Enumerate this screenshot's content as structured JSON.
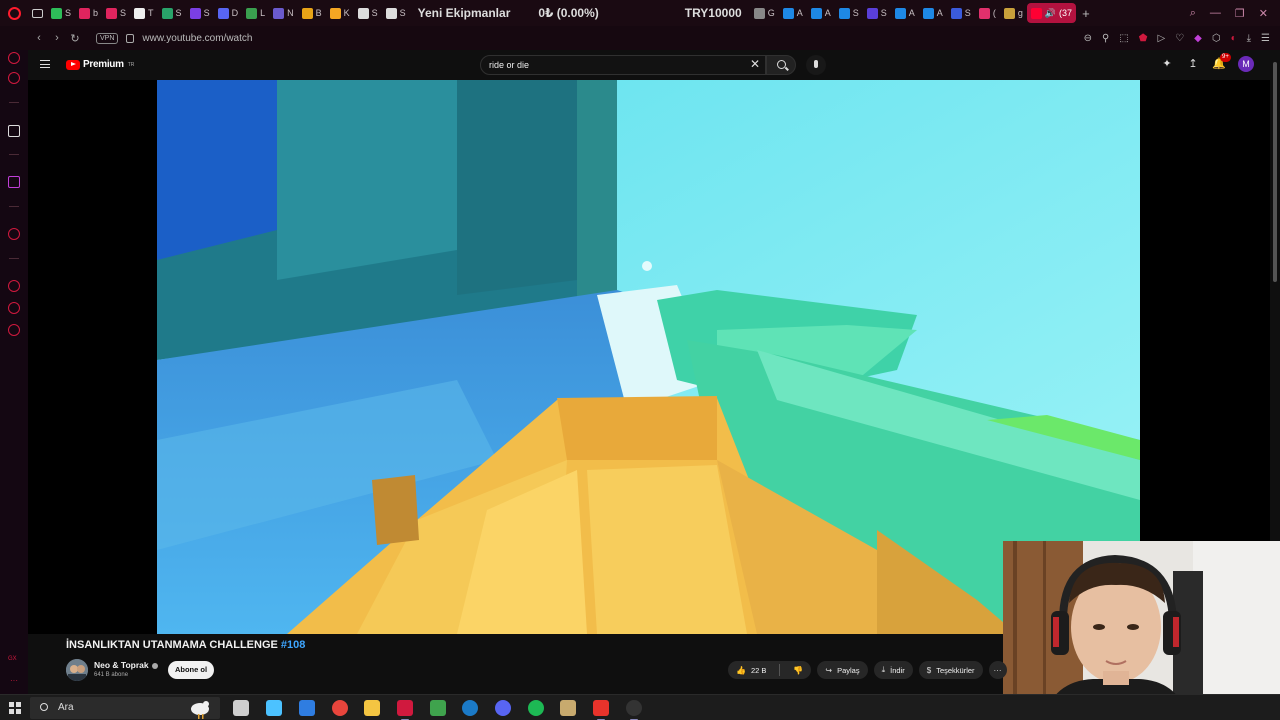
{
  "browser": {
    "tabs": [
      {
        "label": "S",
        "color": "#2ebd59"
      },
      {
        "label": "b",
        "color": "#e0245e"
      },
      {
        "label": "S",
        "color": "#e0245e"
      },
      {
        "label": "T",
        "color": "#eeeeee"
      },
      {
        "label": "S",
        "color": "#29a36a"
      },
      {
        "label": "S",
        "color": "#7b3fe4"
      },
      {
        "label": "D",
        "color": "#5865f2"
      },
      {
        "label": "L",
        "color": "#3a9f4f"
      },
      {
        "label": "N",
        "color": "#6a5acd"
      },
      {
        "label": "B",
        "color": "#e8a317"
      },
      {
        "label": "K",
        "color": "#f5a623"
      },
      {
        "label": "S",
        "color": "#dddddd"
      },
      {
        "label": "S",
        "color": "#dddddd"
      }
    ],
    "text_tabs": [
      "Yeni Ekipmanlar",
      "0₺ (0.00%)",
      "TRY10000"
    ],
    "tabs2": [
      {
        "label": "G",
        "color": "#888888"
      },
      {
        "label": "A",
        "color": "#1e88e5"
      },
      {
        "label": "A",
        "color": "#1e88e5"
      },
      {
        "label": "S",
        "color": "#1e88e5"
      },
      {
        "label": "S",
        "color": "#5a3fd8"
      },
      {
        "label": "A",
        "color": "#1e88e5"
      },
      {
        "label": "A",
        "color": "#1e88e5"
      },
      {
        "label": "S",
        "color": "#3b5bdb"
      },
      {
        "label": "(",
        "color": "#e1306c"
      },
      {
        "label": "g",
        "color": "#c9a13b"
      }
    ],
    "active_tab": {
      "label": "(37",
      "color": "#ff0033"
    },
    "url": "www.youtube.com/watch",
    "vpn_label": "VPN"
  },
  "youtube": {
    "logo_text": "Premium",
    "logo_region": "TR",
    "search_value": "ride or die",
    "notification_count": "9+",
    "avatar_letter": "M",
    "video": {
      "title": "İNSANLIKTAN UTANMAMA CHALLENGE",
      "hashtag": "#108",
      "channel": "Neo & Toprak",
      "subscribers": "641 B abone",
      "subscribe_label": "Abone ol",
      "likes": "22 B",
      "share_label": "Paylaş",
      "download_label": "İndir",
      "thanks_label": "Teşekkürler"
    }
  },
  "taskbar": {
    "search_placeholder": "Ara",
    "apps": [
      {
        "name": "task-view",
        "color": "#cfcfcf"
      },
      {
        "name": "copilot",
        "color": "#4cc2ff"
      },
      {
        "name": "store",
        "color": "#2f7de1"
      },
      {
        "name": "chrome",
        "color": "#e8453c"
      },
      {
        "name": "explorer",
        "color": "#f4c542"
      },
      {
        "name": "opera",
        "color": "#d0193e"
      },
      {
        "name": "app-green",
        "color": "#3fa34d"
      },
      {
        "name": "steam",
        "color": "#1b7ac7"
      },
      {
        "name": "discord",
        "color": "#5865f2"
      },
      {
        "name": "spotify",
        "color": "#1db954"
      },
      {
        "name": "league",
        "color": "#c8aa6e"
      },
      {
        "name": "lightning-app",
        "color": "#e8332b"
      },
      {
        "name": "obs",
        "color": "#333333"
      }
    ]
  }
}
